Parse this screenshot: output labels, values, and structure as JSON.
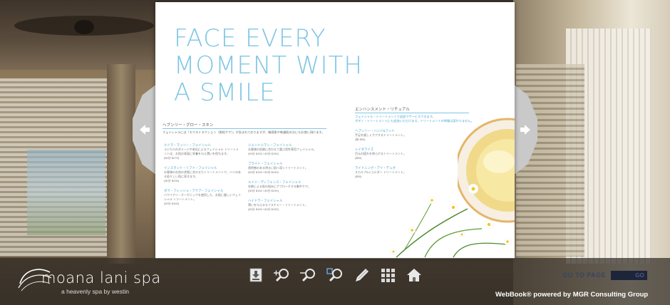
{
  "colors": {
    "accent": "#7fc6e4",
    "toolbar": "#302b24",
    "goto": "#1c253a"
  },
  "page": {
    "headline_lines": [
      "FACE EVERY",
      "MOMENT WITH",
      "A SMILE"
    ],
    "left_section_title": "ヘブンリー・グロー・スキン",
    "left_intro": "フェイシャルには「エクストラクション（角栓ケア）」が含まれておりますが、敏感肌や乾燥肌の方にもお使い頂けます。",
    "right_section_title": "エンハンスメント・リチュアル",
    "right_intro": "フェイシャル・トリートメントで追加でサービスできます。",
    "right_intro2": "ボディ・トリートメントにも追加いただけます。トリートメントの時間は変わりません。",
    "left_column": [
      {
        "title": "ヒドラ・マッソー・フェイシャル",
        "body": "ラジカルのダメージや老化によるフェイシャル トリートメントは、お肌の表面に栄養を与え潤いを保ちます。",
        "price": "(80分 $270)"
      },
      {
        "title": "インスタント・リフト・フェイシャル",
        "body": "お客様のお肌の状態に合わせたトリートメントで、ハリのある若々しい肌に導きます。",
        "price": "(80分 $230)"
      },
      {
        "title": "ダマ・フレッシュ・アクア・フェイシャル",
        "body": "ハワイアン・オーガニックを使用した、お肌に優しいフェイシャル トリートメント。",
        "price": "(50分 $160)"
      }
    ],
    "middle_column": [
      {
        "title": "ジェントルマン・フェイシャル",
        "body": "お客様の肌質に合わせて選ぶ男性専用フェイシャル。",
        "price": "(50分 $150 / 80分 $190)"
      },
      {
        "title": "ブライト・フェイシャル",
        "body": "透明感のある明るい肌へ導くトリートメント。",
        "price": "(50分 $150 / 80分 $190)"
      },
      {
        "title": "エイジ・ディフェンス・フェイシャル",
        "body": "年齢による肌の悩みにアプローチする集中ケア。",
        "price": "(50分 $150 / 80分 $190)"
      },
      {
        "title": "ハイドラ・フェイシャル",
        "body": "潤いを与えるモイスチャー・トリートメント。",
        "price": "(50分 $150 / 80分 $190)"
      }
    ],
    "right_column": [
      {
        "title": "ヘブンリー・ハンド&フット",
        "body": "手足を優しくケアするトリートメント。",
        "price": "(各 $50)"
      },
      {
        "title": "レイダライズ",
        "body": "目元の疲れを和らげるトリートメント。",
        "price": "($50)"
      },
      {
        "title": "ライトニング・アイ・デュオ",
        "body": "スカルプ&ショルダー トリートメント。",
        "price": "($50)"
      }
    ]
  },
  "toolbar": {
    "logo_name": "moana lani spa",
    "logo_tagline": "a heavenly spa by westin",
    "tools": [
      {
        "name": "download-icon",
        "label": "Download"
      },
      {
        "name": "zoom-in-icon",
        "label": "Zoom in"
      },
      {
        "name": "zoom-out-icon",
        "label": "Zoom out"
      },
      {
        "name": "zoom-area-icon",
        "label": "Zoom area"
      },
      {
        "name": "pen-icon",
        "label": "Annotate"
      },
      {
        "name": "thumbnails-icon",
        "label": "Thumbnails"
      },
      {
        "name": "home-icon",
        "label": "Home"
      }
    ],
    "goto_label": "GO TO PAGE",
    "goto_value": "",
    "goto_button": "GO",
    "powered_by": "WebBook® powered by MGR Consulting Group"
  },
  "navigation": {
    "prev_icon": "arrow-left-icon",
    "next_icon": "arrow-right-icon"
  }
}
